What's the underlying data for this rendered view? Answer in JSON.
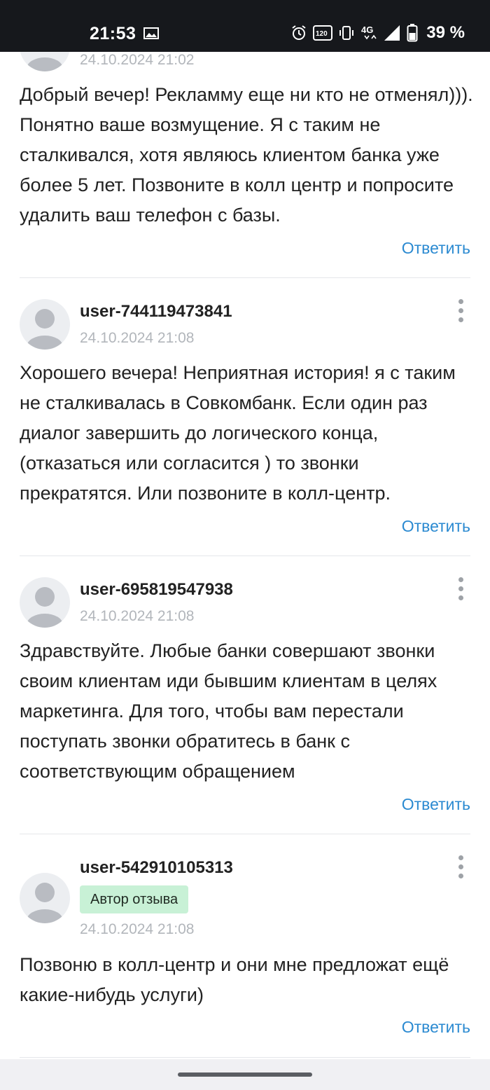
{
  "status_bar": {
    "time": "21:53",
    "battery_percent": "39 %",
    "network": "4G",
    "refresh_rate": "120"
  },
  "comments": [
    {
      "date": "24.10.2024 21:02",
      "text": "Добрый вечер! Рекламму еще ни кто не отменял))). Понятно ваше возмущение. Я с таким не сталкивался, хотя являюсь клиентом банка уже более 5 лет. Позвоните в колл центр и попросите удалить ваш телефон с базы.",
      "reply_label": "Ответить"
    },
    {
      "username": "user-744119473841",
      "date": "24.10.2024 21:08",
      "text": "Хорошего вечера! Неприятная история! я с таким не сталкивалась в Совкомбанк. Если один раз диалог завершить до логического конца, (отказаться или согласится ) то звонки прекратятся. Или позвоните в колл-центр.",
      "reply_label": "Ответить"
    },
    {
      "username": "user-695819547938",
      "date": "24.10.2024 21:08",
      "text": "Здравствуйте. Любые банки совершают звонки своим клиентам иди бывшим клиентам в целях маркетинга. Для того, чтобы вам перестали поступать звонки обратитесь в банк с соответствующим обращением",
      "reply_label": "Ответить"
    },
    {
      "username": "user-542910105313",
      "badge": "Автор отзыва",
      "date": "24.10.2024 21:08",
      "text": "Позвоню в колл-центр и они мне предложат ещё какие-нибудь услуги)",
      "reply_label": "Ответить"
    }
  ],
  "colors": {
    "link": "#2b8ad1",
    "badge_bg": "#c8f1d6",
    "date": "#b2b6bb",
    "status_bar_bg": "#16181c"
  },
  "icons": [
    "image-icon",
    "alarm-icon",
    "refresh-rate-icon",
    "vibrate-icon",
    "network-4g-icon",
    "signal-icon",
    "battery-icon",
    "more-vertical-icon",
    "avatar-placeholder-icon"
  ]
}
